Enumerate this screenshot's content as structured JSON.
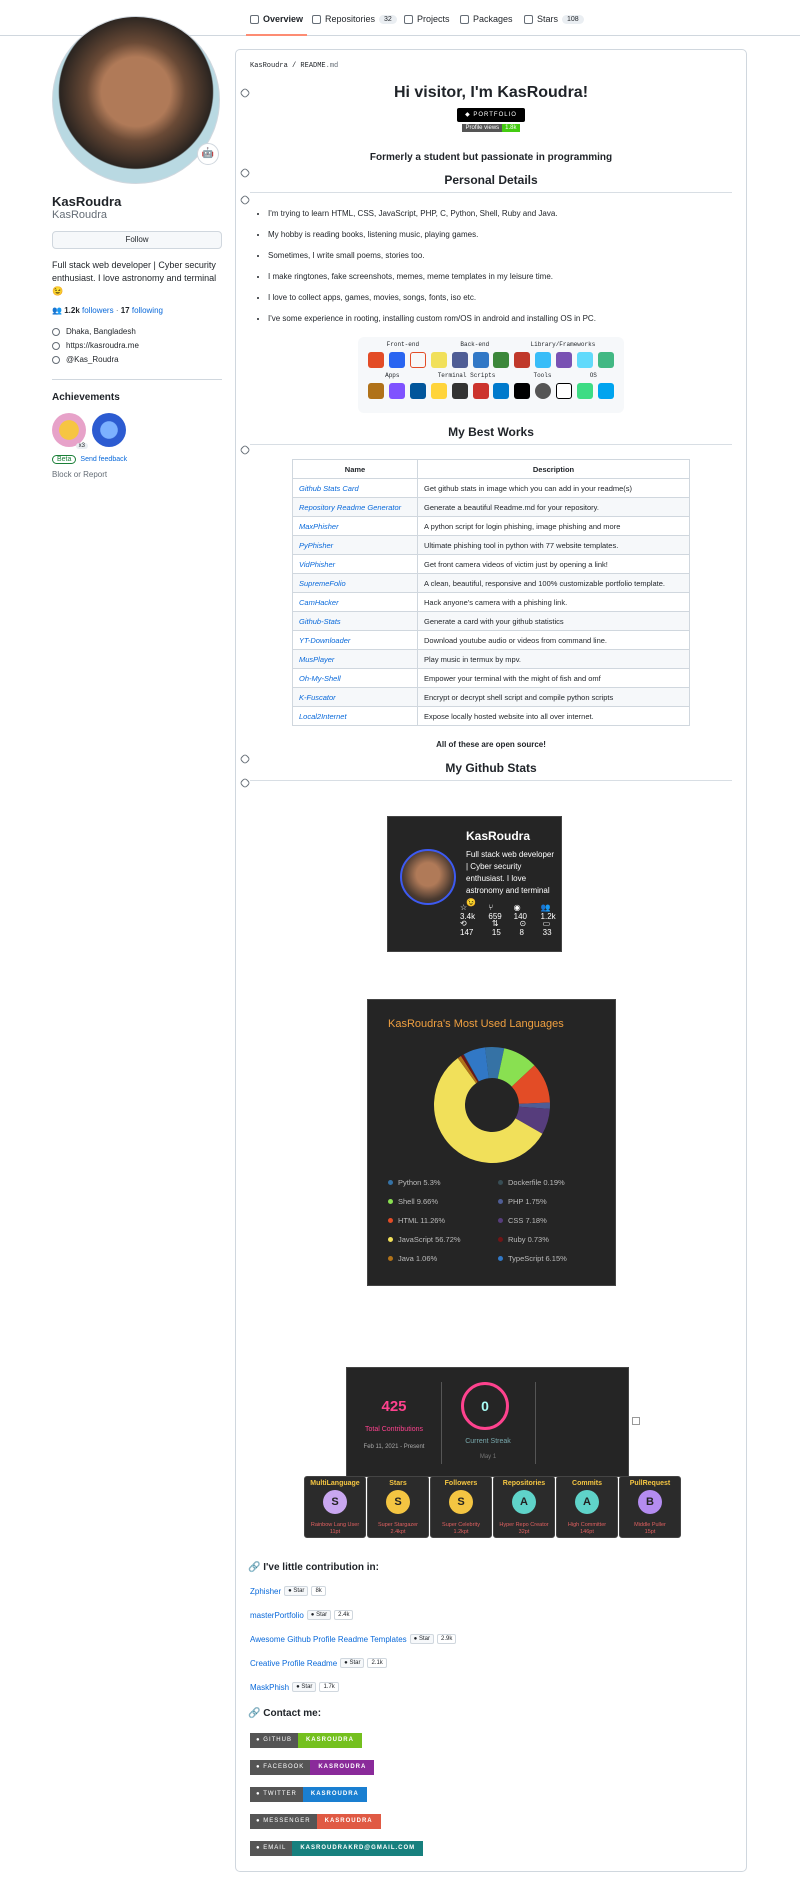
{
  "nav": {
    "tabs": [
      {
        "label": "Overview"
      },
      {
        "label": "Repositories",
        "count": "32"
      },
      {
        "label": "Projects"
      },
      {
        "label": "Packages"
      },
      {
        "label": "Stars",
        "count": "108"
      }
    ]
  },
  "profile": {
    "name": "KasRoudra",
    "login": "KasRoudra",
    "follow": "Follow",
    "bio": "Full stack web developer | Cyber security enthusiast. I love astronomy and terminal 😉",
    "followers": "1.2k",
    "followers_label": "followers",
    "following": "17",
    "following_label": "following",
    "location": "Dhaka, Bangladesh",
    "website": "https://kasroudra.me",
    "twitter": "@Kas_Roudra",
    "achievements_title": "Achievements",
    "achievement_count": "x3",
    "beta": "Beta",
    "feedback": "Send feedback",
    "block": "Block or Report"
  },
  "readme": {
    "crumb_user": "KasRoudra",
    "crumb_file": "README",
    "crumb_ext": ".md",
    "title": "Hi visitor, I'm KasRoudra!",
    "portfolio": "PORTFOLIO",
    "pv_label": "Profile views",
    "pv_count": "1.8k",
    "tagline": "Formerly a student but passionate in programming",
    "personal_title": "Personal Details",
    "details": [
      "I'm trying to learn HTML, CSS, JavaScript, PHP, C, Python, Shell, Ruby and Java.",
      "My hobby is reading books, listening music, playing games.",
      "Sometimes, I write small poems, stories too.",
      "I make ringtones, fake screenshots, memes, meme templates in my leisure time.",
      "I love to collect apps, games, movies, songs, fonts, iso etc.",
      "I've some experience in rooting, installing custom rom/OS in android and installing OS in PC."
    ],
    "skills_headers_1": [
      "Front-end",
      "Back-end",
      "Library/Frameworks"
    ],
    "skills_headers_2": [
      "Apps",
      "Terminal Scripts",
      "Tools",
      "OS"
    ],
    "works_title": "My Best Works",
    "col_name": "Name",
    "col_desc": "Description",
    "works": [
      {
        "name": "Github Stats Card",
        "desc": "Get github stats in image which you can add in your readme(s)"
      },
      {
        "name": "Repository Readme Generator",
        "desc": "Generate a beautiful Readme.md for your repository."
      },
      {
        "name": "MaxPhisher",
        "desc": "A python script for login phishing, image phishing and more"
      },
      {
        "name": "PyPhisher",
        "desc": "Ultimate phishing tool in python with 77 website templates."
      },
      {
        "name": "VidPhisher",
        "desc": "Get front camera videos of victim just by opening a link!"
      },
      {
        "name": "SupremeFolio",
        "desc": "A clean, beautiful, responsive and 100% customizable portfolio template."
      },
      {
        "name": "CamHacker",
        "desc": "Hack anyone's camera with a phishing link."
      },
      {
        "name": "Github-Stats",
        "desc": "Generate a card with your github statistics"
      },
      {
        "name": "YT-Downloader",
        "desc": "Download youtube audio or videos from command line."
      },
      {
        "name": "MusPlayer",
        "desc": "Play music in termux by mpv."
      },
      {
        "name": "Oh-My-Shell",
        "desc": "Empower your terminal with the might of fish and omf"
      },
      {
        "name": "K-Fuscator",
        "desc": "Encrypt or decrypt shell script and compile python scripts"
      },
      {
        "name": "Local2Internet",
        "desc": "Expose locally hosted website into all over internet."
      }
    ],
    "open_source": "All of these are open source!",
    "stats_title": "My Github Stats",
    "stat_card": {
      "name": "KasRoudra",
      "desc": "Full stack web developer | Cyber security enthusiast. I love astronomy and terminal😉",
      "stars": "3.4k",
      "forks": "659",
      "watch": "140",
      "followers": "1.2k",
      "commits": "147",
      "prs": "15",
      "issues": "8",
      "repos": "33"
    },
    "lang_title": "KasRoudra's Most Used Languages",
    "streak": {
      "total": "425",
      "total_label": "Total Contributions",
      "range": "Feb 11, 2021 - Present",
      "current": "0",
      "current_label": "Current Streak",
      "current_date": "May 1"
    },
    "trophies": [
      {
        "title": "MultiLanguage",
        "rank": "S",
        "sub": "Rainbow Lang User",
        "pts": "11pt",
        "color": "#c9a7f0"
      },
      {
        "title": "Stars",
        "rank": "S",
        "sub": "Super Stargazer",
        "pts": "2.4kpt",
        "color": "#f4c542"
      },
      {
        "title": "Followers",
        "rank": "S",
        "sub": "Super Celebrity",
        "pts": "1.2kpt",
        "color": "#f4c542"
      },
      {
        "title": "Repositories",
        "rank": "A",
        "sub": "Hyper Repo Creator",
        "pts": "32pt",
        "color": "#5fd3c9"
      },
      {
        "title": "Commits",
        "rank": "A",
        "sub": "High Committer",
        "pts": "146pt",
        "color": "#5fd3c9"
      },
      {
        "title": "PullRequest",
        "rank": "B",
        "sub": "Middle Puller",
        "pts": "15pt",
        "color": "#b48cf0"
      }
    ],
    "contrib_title": "I've little contribution in:",
    "contributions": [
      {
        "name": "Zphisher",
        "star": "Star",
        "count": "8k"
      },
      {
        "name": "masterPortfolio",
        "star": "Star",
        "count": "2.4k"
      },
      {
        "name": "Awesome Github Profile Readme Templates",
        "star": "Star",
        "count": "2.9k"
      },
      {
        "name": "Creative Profile Readme",
        "star": "Star",
        "count": "2.1k"
      },
      {
        "name": "MaskPhish",
        "star": "Star",
        "count": "1.7k"
      }
    ],
    "contact_title": "Contact me:",
    "contacts": [
      {
        "label": "GITHUB",
        "value": "KASROUDRA",
        "color": "#74c01e"
      },
      {
        "label": "FACEBOOK",
        "value": "KASROUDRA",
        "color": "#8a2a9a"
      },
      {
        "label": "TWITTER",
        "value": "KASROUDRA",
        "color": "#1a7fd1"
      },
      {
        "label": "MESSENGER",
        "value": "KASROUDRA",
        "color": "#e05a44"
      },
      {
        "label": "EMAIL",
        "value": "KASROUDRAKRD@GMAIL.COM",
        "color": "#17807e"
      }
    ]
  },
  "chart_data": {
    "type": "pie",
    "title": "KasRoudra's Most Used Languages",
    "categories": [
      "Python",
      "Dockerfile",
      "Shell",
      "PHP",
      "HTML",
      "CSS",
      "JavaScript",
      "Ruby",
      "Java",
      "TypeScript"
    ],
    "values": [
      5.3,
      0.19,
      9.66,
      1.75,
      11.26,
      7.18,
      56.72,
      0.73,
      1.06,
      6.15
    ],
    "labels": [
      "Python 5.3%",
      "Dockerfile 0.19%",
      "Shell 9.66%",
      "PHP 1.75%",
      "HTML 11.26%",
      "CSS 7.18%",
      "JavaScript 56.72%",
      "Ruby 0.73%",
      "Java 1.06%",
      "TypeScript 6.15%"
    ],
    "colors": [
      "#3572A5",
      "#384d54",
      "#89e051",
      "#4F5D95",
      "#e34c26",
      "#563d7c",
      "#f1e05a",
      "#701516",
      "#b07219",
      "#3178c6"
    ],
    "legend": "bottom"
  }
}
